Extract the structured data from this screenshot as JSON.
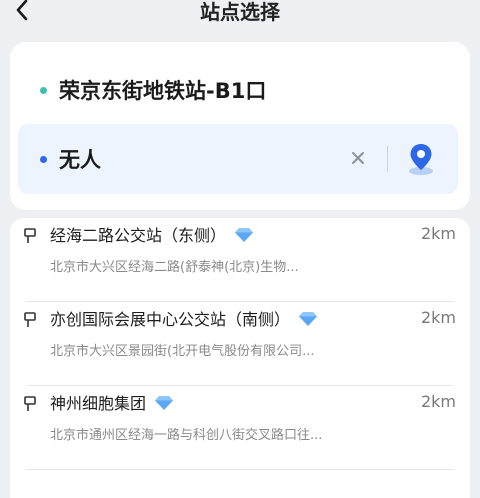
{
  "header": {
    "title": "站点选择",
    "back_icon": "chevron-left-icon"
  },
  "route": {
    "start": {
      "label": "荣京东街地铁站-B1口",
      "dot_color": "#3cc3b0"
    },
    "end": {
      "label": "无人",
      "dot_color": "#2c68e8"
    },
    "clear_icon": "close-icon",
    "map_icon": "location-pin-icon",
    "accent_color": "#2c68e8"
  },
  "stations": [
    {
      "name": "经海二路公交站（东侧）",
      "distance": "2km",
      "address": "北京市大兴区经海二路(舒泰神(北京)生物...",
      "badge_icon": "diamond-icon"
    },
    {
      "name": "亦创国际会展中心公交站（南侧）",
      "distance": "2km",
      "address": "北京市大兴区景园街(北开电气股份有限公司...",
      "badge_icon": "diamond-icon"
    },
    {
      "name": "神州细胞集团",
      "distance": "2km",
      "address": "北京市通州区经海一路与科创八街交叉路口往...",
      "badge_icon": "diamond-icon"
    }
  ]
}
